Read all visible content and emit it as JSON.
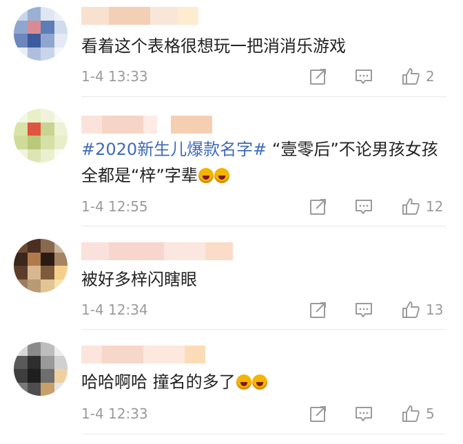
{
  "comments": [
    {
      "text": "看着这个表格很想玩一把消消乐游戏",
      "time": "1-4 13:33",
      "likes": "2"
    },
    {
      "tag": "#2020新生儿爆款名字#",
      "text": " “壹零后”不论男孩女孩全都是“梓”字辈",
      "time": "1-4 12:55",
      "likes": "12"
    },
    {
      "text": "被好多梓闪瞎眼",
      "time": "1-4 12:34",
      "likes": "13"
    },
    {
      "text": "哈哈啊哈 撞名的多了",
      "time": "1-4 12:33",
      "likes": "5"
    }
  ],
  "icons": {
    "share": "share-icon",
    "reply": "comment-icon",
    "like": "thumbs-up-icon"
  }
}
